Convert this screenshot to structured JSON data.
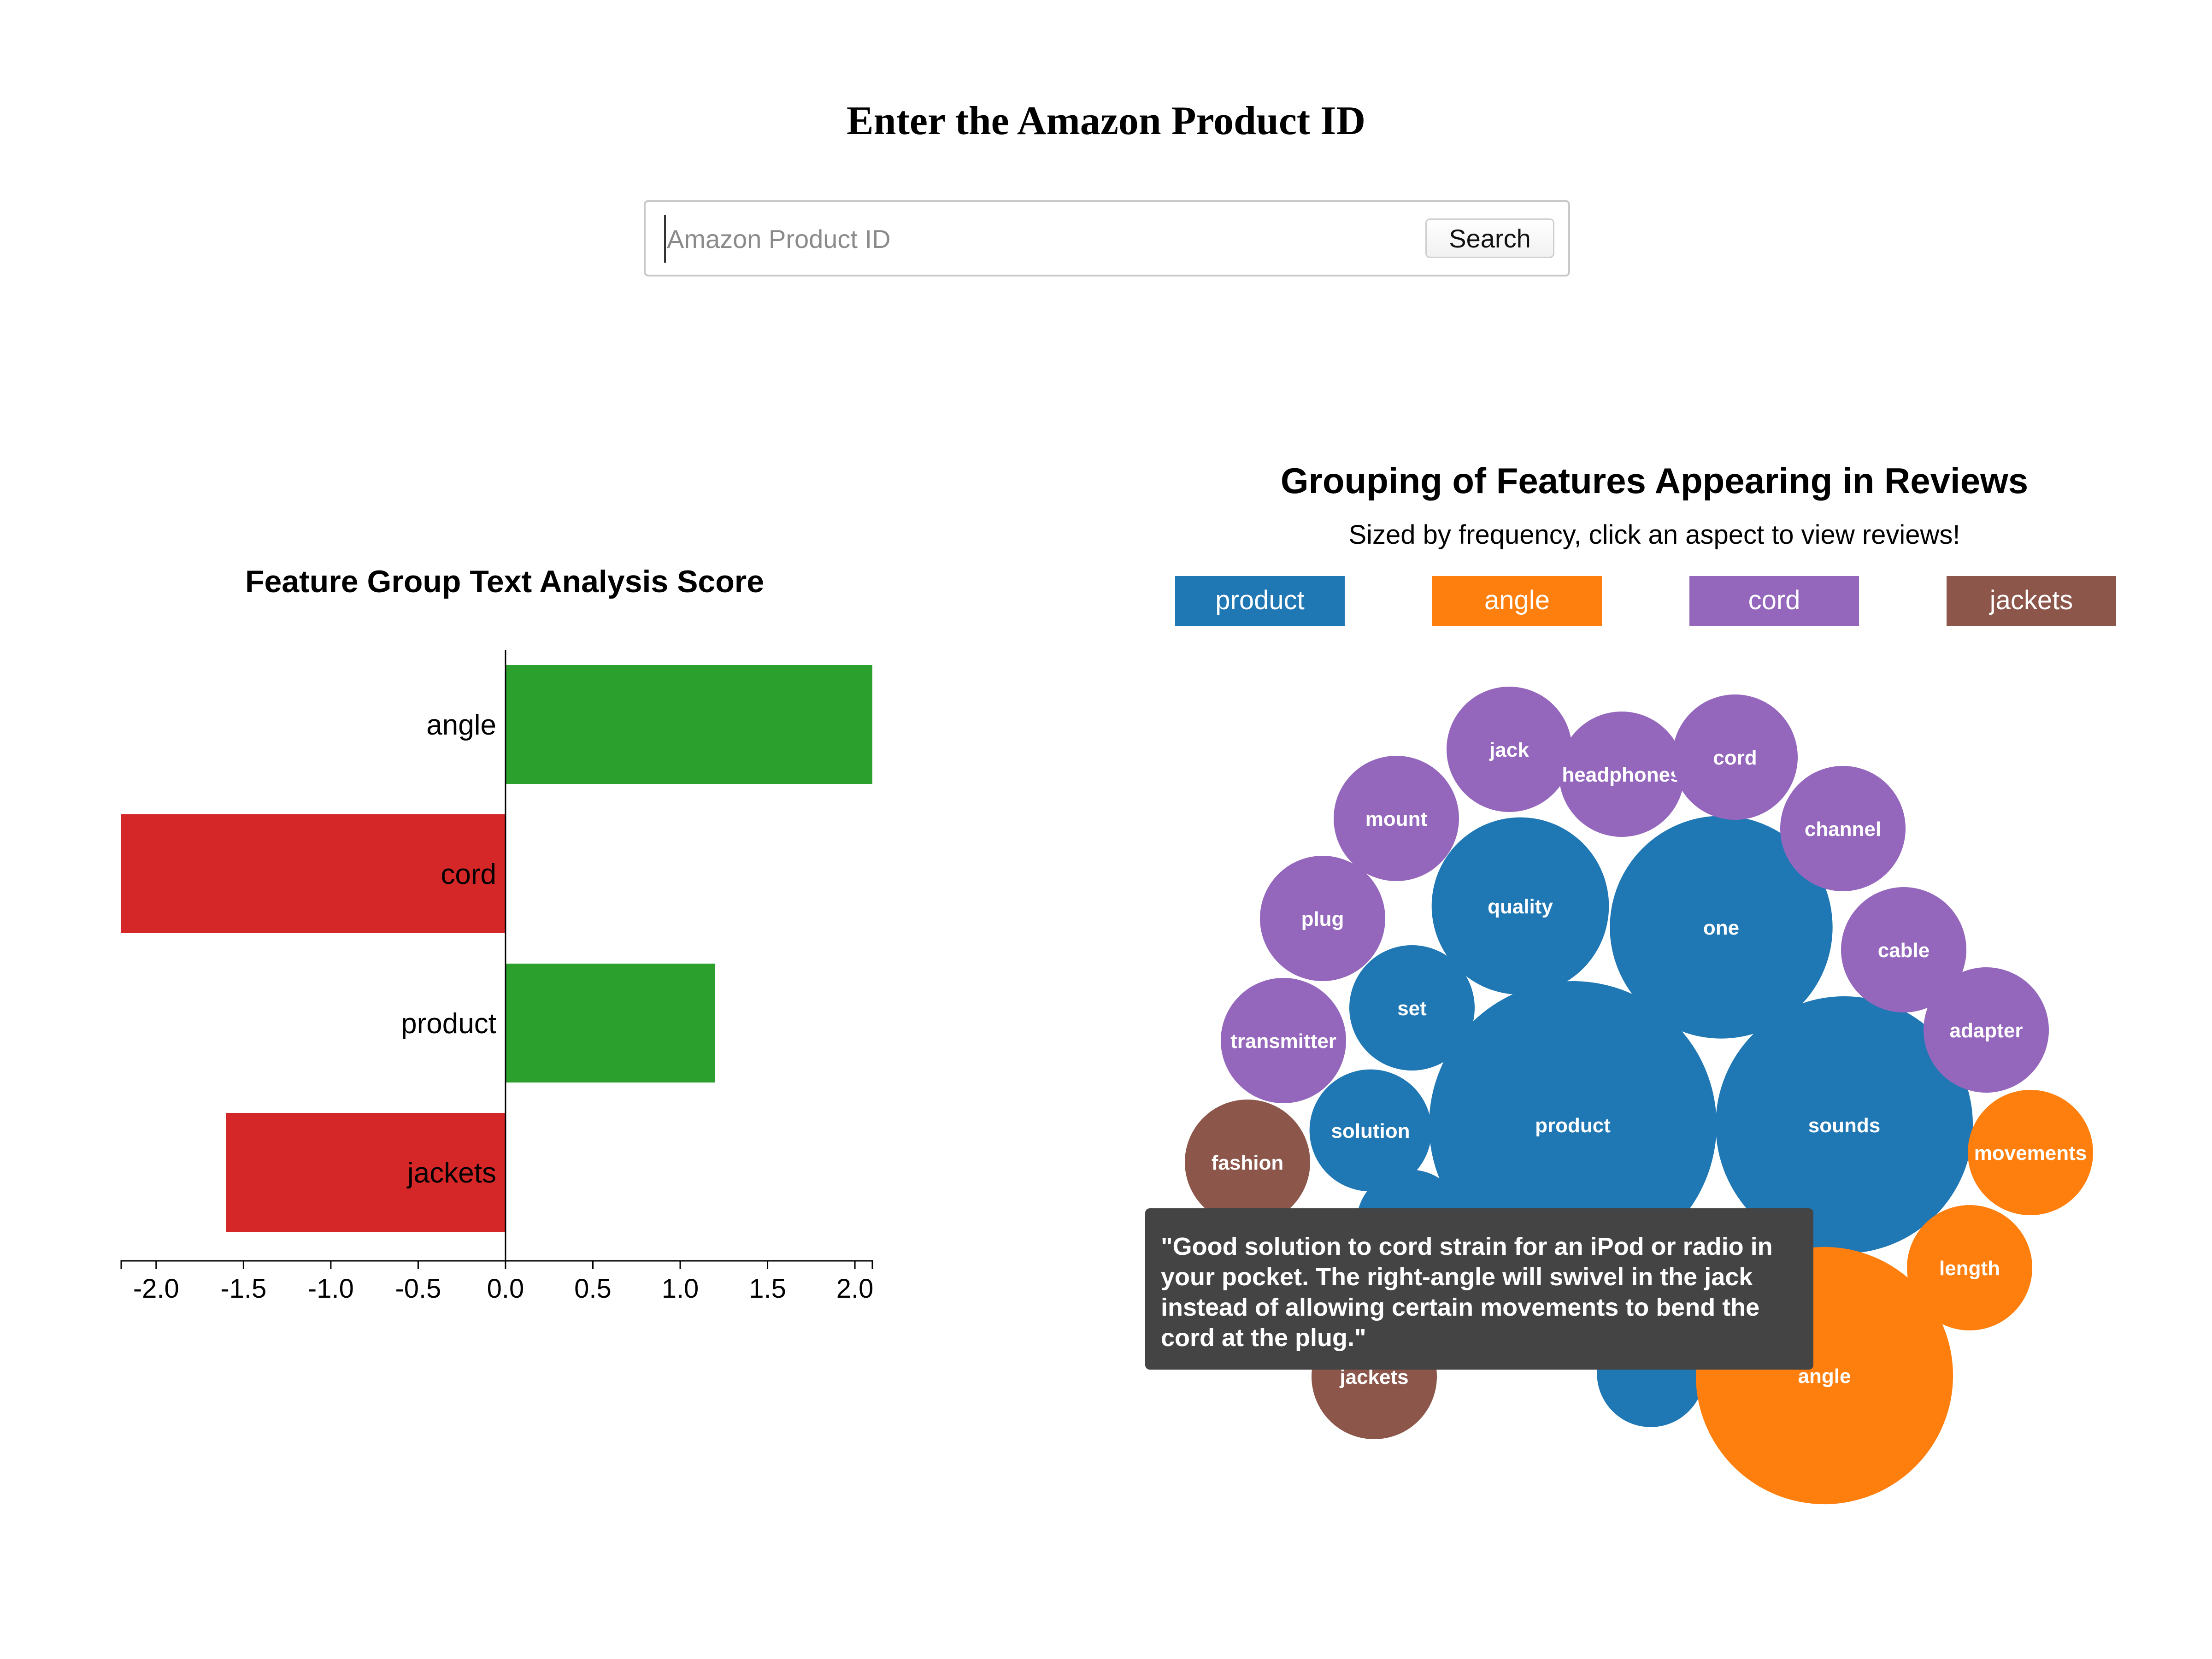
{
  "header": {
    "title": "Enter the Amazon Product ID"
  },
  "search": {
    "placeholder": "Amazon Product ID",
    "button_label": "Search"
  },
  "colors": {
    "positive": "#2ca02c",
    "negative": "#d62728",
    "product": "#1f77b4",
    "angle": "#ff7f0e",
    "cord": "#9467bd",
    "jackets": "#8c564b",
    "tooltip_bg": "#444444"
  },
  "chart_data": [
    {
      "type": "bar",
      "orientation": "horizontal",
      "title": "Feature Group Text Analysis Score",
      "categories": [
        "angle",
        "cord",
        "product",
        "jackets"
      ],
      "values": [
        2.1,
        -2.2,
        1.2,
        -1.6
      ],
      "xlim": [
        -2.2,
        2.1
      ],
      "xticks": [
        "-2.0",
        "-1.5",
        "-1.0",
        "-0.5",
        "0.0",
        "0.5",
        "1.0",
        "1.5",
        "2.0"
      ],
      "grid": false
    },
    {
      "type": "bubble",
      "title": "Grouping of Features Appearing in Reviews",
      "subtitle": "Sized by frequency, click an aspect to view reviews!",
      "legend": [
        "product",
        "angle",
        "cord",
        "jackets"
      ],
      "legend_position": "top",
      "bubbles": [
        {
          "label": "product",
          "group": "product",
          "size": 100
        },
        {
          "label": "sounds",
          "group": "product",
          "size": 80
        },
        {
          "label": "one",
          "group": "product",
          "size": 60
        },
        {
          "label": "quality",
          "group": "product",
          "size": 38
        },
        {
          "label": "set",
          "group": "product",
          "size": 19
        },
        {
          "label": "solution",
          "group": "product",
          "size": 18
        },
        {
          "label": "",
          "group": "product",
          "size": 14
        },
        {
          "label": "",
          "group": "product",
          "size": 14
        },
        {
          "label": "",
          "group": "product",
          "size": 12
        },
        {
          "label": "angle",
          "group": "angle",
          "size": 80
        },
        {
          "label": "movements",
          "group": "angle",
          "size": 19
        },
        {
          "label": "length",
          "group": "angle",
          "size": 19
        },
        {
          "label": "jack",
          "group": "cord",
          "size": 19
        },
        {
          "label": "headphones",
          "group": "cord",
          "size": 19
        },
        {
          "label": "cord",
          "group": "cord",
          "size": 19
        },
        {
          "label": "mount",
          "group": "cord",
          "size": 19
        },
        {
          "label": "channel",
          "group": "cord",
          "size": 19
        },
        {
          "label": "plug",
          "group": "cord",
          "size": 19
        },
        {
          "label": "cable",
          "group": "cord",
          "size": 19
        },
        {
          "label": "transmitter",
          "group": "cord",
          "size": 19
        },
        {
          "label": "adapter",
          "group": "cord",
          "size": 19
        },
        {
          "label": "fashion",
          "group": "jackets",
          "size": 19
        },
        {
          "label": "jackets",
          "group": "jackets",
          "size": 19
        }
      ]
    }
  ],
  "tooltip": {
    "lines": [
      "\"Good solution to cord strain for an iPod or radio in",
      "your pocket. The right-angle will swivel in the jack",
      "instead of allowing certain movements to bend the",
      "cord at the plug.\""
    ]
  }
}
